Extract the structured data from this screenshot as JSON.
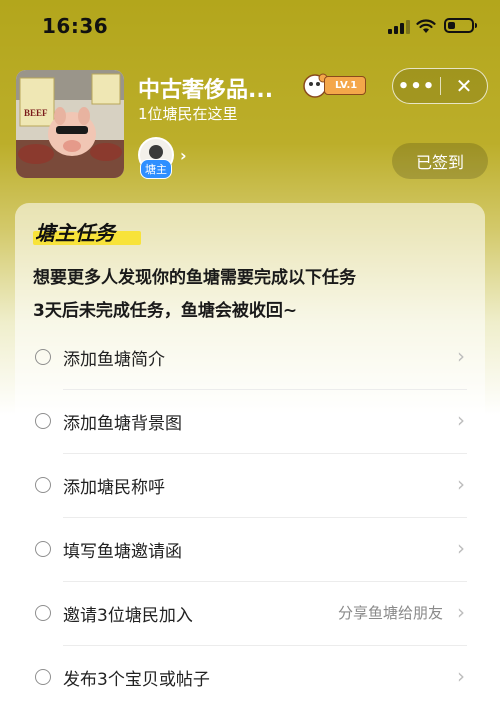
{
  "status_bar": {
    "time": "16:36",
    "battery_level": 0.3
  },
  "header": {
    "title": "中古奢侈品...",
    "members_text": "1位塘民在这里",
    "level_label": "LV.1",
    "more_label": "•••",
    "close_label": "✕",
    "owner_tag": "塘主",
    "owner_chevron": "›",
    "signed_label": "已签到",
    "thumb_text_beef": "BEEF"
  },
  "card": {
    "title": "塘主任务",
    "desc_line1": "想要更多人发现你的鱼塘需要完成以下任务",
    "desc_line2": "3天后未完成任务，鱼塘会被收回~",
    "tasks": [
      {
        "label": "添加鱼塘简介",
        "hint": ""
      },
      {
        "label": "添加鱼塘背景图",
        "hint": ""
      },
      {
        "label": "添加塘民称呼",
        "hint": ""
      },
      {
        "label": "填写鱼塘邀请函",
        "hint": ""
      },
      {
        "label": "邀请3位塘民加入",
        "hint": "分享鱼塘给朋友"
      },
      {
        "label": "发布3个宝贝或帖子",
        "hint": ""
      }
    ],
    "chevron": "›"
  },
  "colors": {
    "header_bg": "#b3a61c",
    "highlight": "#f8e33a",
    "owner_tag": "#2f8fff",
    "level_badge": "#f4a74a"
  }
}
